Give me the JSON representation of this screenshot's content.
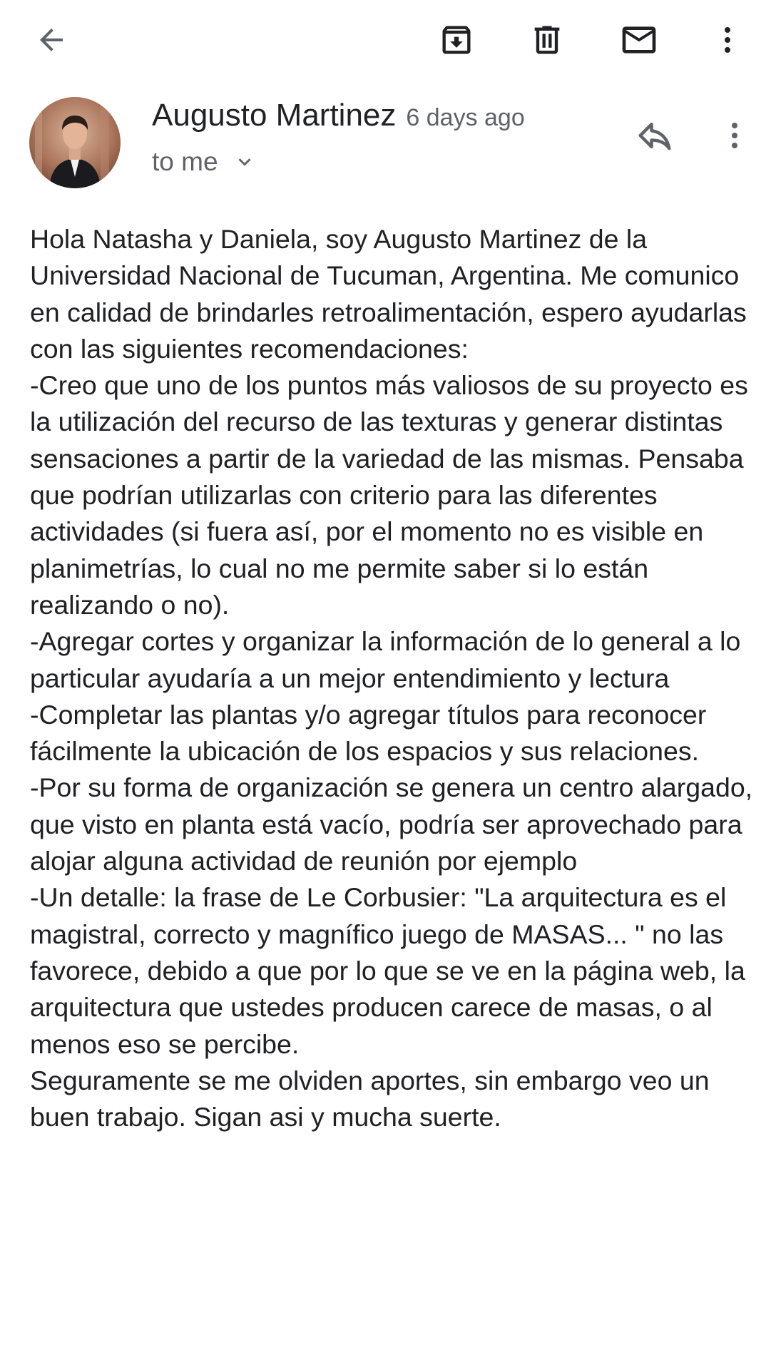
{
  "toolbar": {
    "back_icon": "arrow-back-icon",
    "archive_icon": "archive-icon",
    "delete_icon": "delete-icon",
    "mark_unread_icon": "mail-icon",
    "more_icon": "more-vert-icon"
  },
  "message": {
    "sender": "Augusto Martinez",
    "time": "6 days ago",
    "recipient": "to me",
    "reply_icon": "reply-icon",
    "more_icon": "more-vert-icon",
    "body": [
      "Hola Natasha y Daniela, soy Augusto Martinez de la Universidad Nacional de Tucuman, Argentina. Me comunico en calidad de brindarles retroalimentación, espero ayudarlas con las siguientes recomendaciones:",
      "-Creo que uno de los puntos más valiosos de su proyecto es la utilización del recurso de las texturas y generar distintas sensaciones a partir de la variedad de las mismas. Pensaba que podrían utilizarlas con criterio para las diferentes actividades (si fuera así, por el momento no es visible en planimetrías, lo cual no me permite saber si lo están realizando o no).",
      "-Agregar cortes y organizar la información de lo general a lo particular ayudaría a un mejor entendimiento y lectura",
      "-Completar las plantas y/o agregar títulos para reconocer fácilmente la ubicación de los espacios y sus relaciones.",
      "-Por su forma de organización se genera un centro alargado, que visto en planta está vacío, podría ser aprovechado para alojar alguna actividad de reunión por ejemplo",
      "-Un detalle: la frase de Le Corbusier: \"La arquitectura es el magistral, correcto y magnífico juego de MASAS... \" no las favorece, debido a que por lo que se ve en la página web, la arquitectura que ustedes producen carece de masas, o al menos eso se percibe.",
      "Seguramente se me olviden aportes, sin embargo veo un buen trabajo. Sigan asi y mucha suerte."
    ]
  }
}
